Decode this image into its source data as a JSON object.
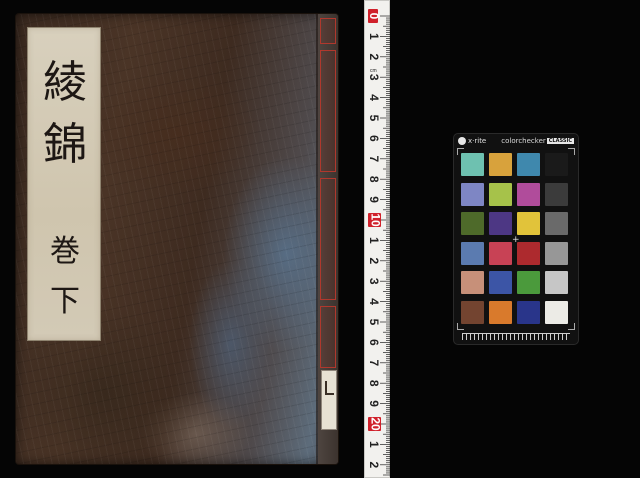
{
  "book": {
    "title_slip_small": "",
    "title_chars": [
      "綾",
      "錦",
      "巻",
      "下"
    ],
    "colors": {
      "cover": "#3f2d22",
      "slip": "#d4cbb6",
      "spine_tab": "#b0382d",
      "ink": "#1d1714"
    }
  },
  "ruler": {
    "major_labels": [
      "0",
      "1",
      "2",
      "3",
      "4",
      "5",
      "6",
      "7",
      "8",
      "9",
      "10",
      "1",
      "2",
      "3",
      "4",
      "5",
      "6",
      "7",
      "8",
      "9",
      "20",
      "1",
      "2",
      "3"
    ],
    "unit_label": "cm",
    "colors": {
      "body": "#f2f1ee",
      "tick": "#222222",
      "accent": "#d0202a"
    }
  },
  "color_checker": {
    "brand": "x·rite",
    "model_prefix": "colorchecker",
    "model_suffix": "CLASSIC",
    "footer_label": "",
    "patches": [
      [
        "#6ec1b0",
        "#d8a23c",
        "#3f88ad",
        "#1a1a1a"
      ],
      [
        "#7e86c4",
        "#a6c24a",
        "#b04c9b",
        "#3b3b3b"
      ],
      [
        "#4e6a2a",
        "#4d3784",
        "#e1c33a",
        "#6a6a6a"
      ],
      [
        "#5b7bb0",
        "#c84255",
        "#ad2a2e",
        "#979797"
      ],
      [
        "#c79079",
        "#3c55a6",
        "#4b9a3c",
        "#c6c6c6"
      ],
      [
        "#734430",
        "#d97a2c",
        "#29358a",
        "#ecebe6"
      ]
    ],
    "crosshair_symbol": "+"
  }
}
